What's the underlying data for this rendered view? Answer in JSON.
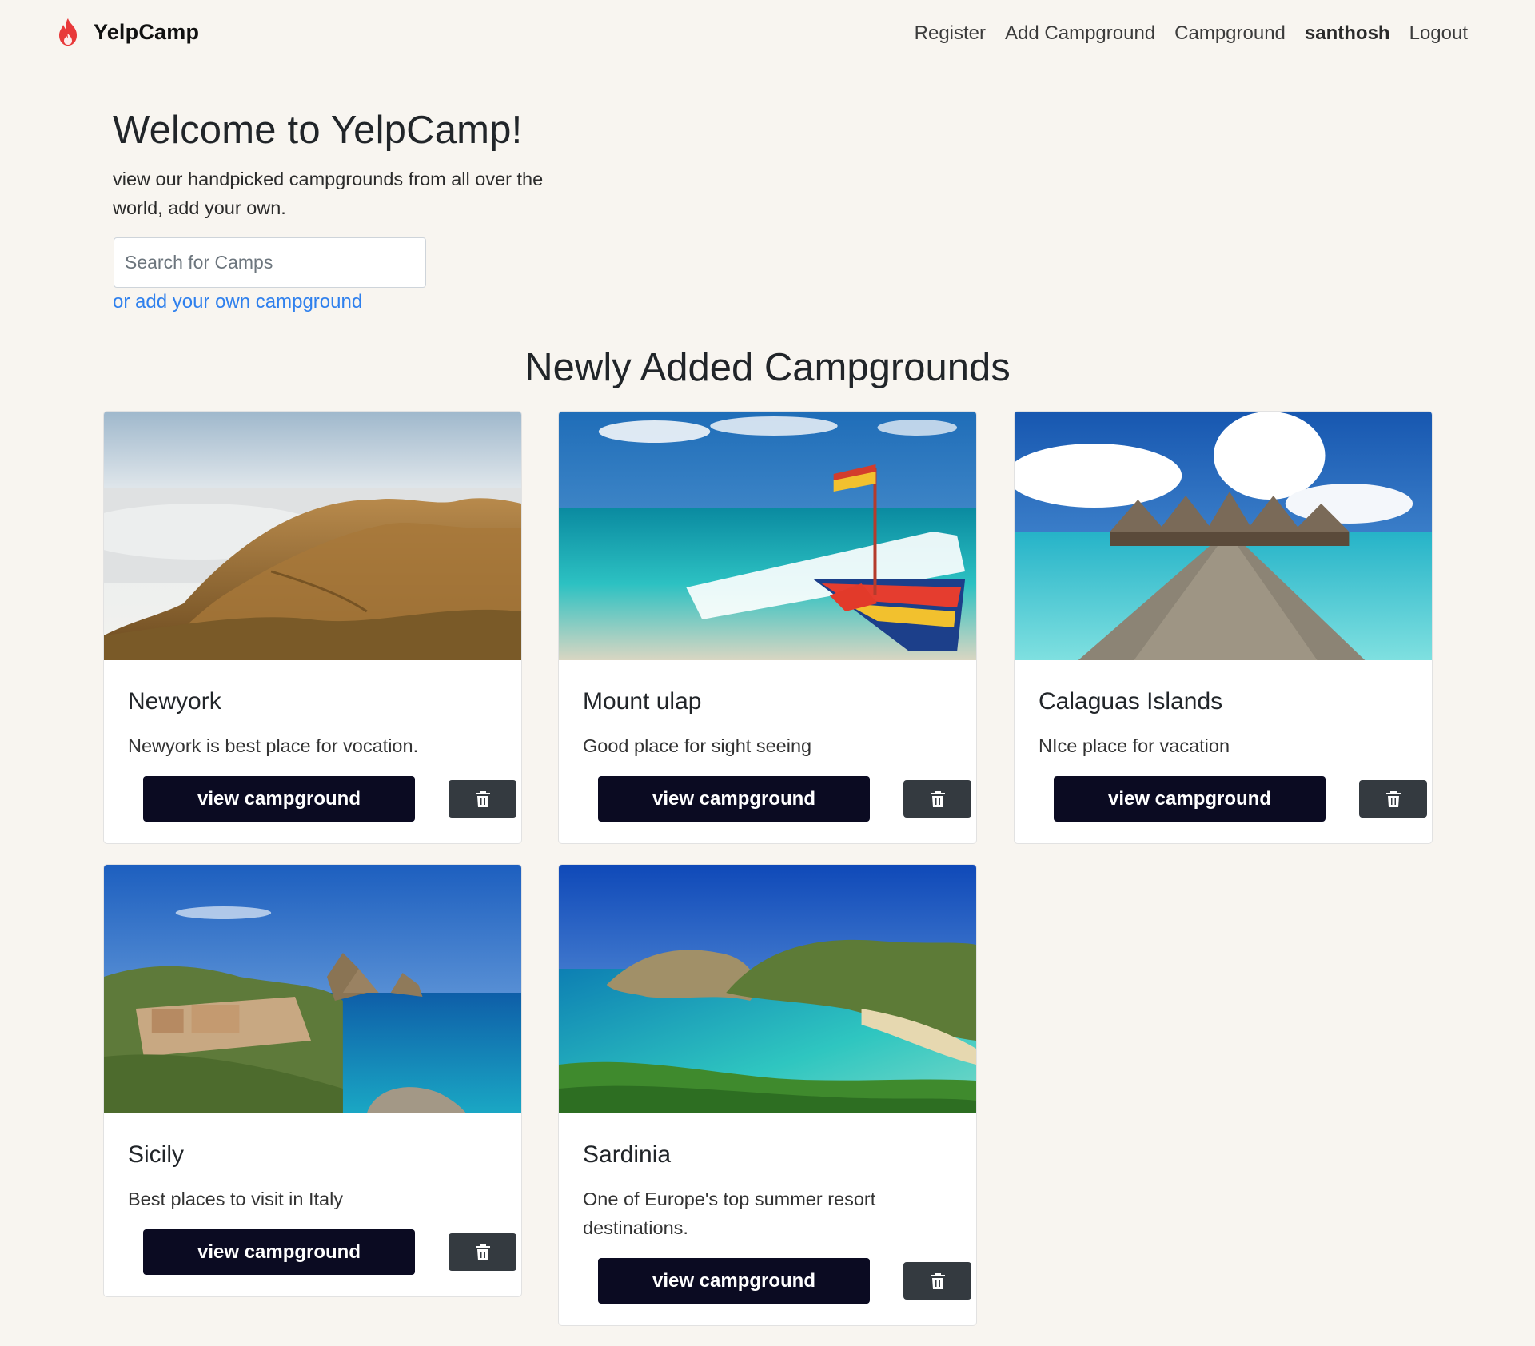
{
  "nav": {
    "brand": "YelpCamp",
    "links": [
      {
        "label": "Register"
      },
      {
        "label": "Add Campground"
      },
      {
        "label": "Campground"
      },
      {
        "label": "santhosh"
      },
      {
        "label": "Logout"
      }
    ]
  },
  "hero": {
    "title": "Welcome to YelpCamp!",
    "subtitle": "view our handpicked campgrounds from all over the world, add your own.",
    "search_placeholder": "Search for Camps",
    "add_link": "or add your own campground"
  },
  "section_title": "Newly Added Campgrounds",
  "campgrounds": [
    {
      "title": "Newyork",
      "description": "Newyork is best place for vocation.",
      "button": "view campground",
      "image": "misty-hills-photo"
    },
    {
      "title": "Mount ulap",
      "description": "Good place for sight seeing",
      "button": "view campground",
      "image": "outrigger-boat-beach-photo"
    },
    {
      "title": "Calaguas Islands",
      "description": "NIce place for vacation",
      "button": "view campground",
      "image": "overwater-huts-pier-photo"
    },
    {
      "title": "Sicily",
      "description": "Best places to visit in Italy",
      "button": "view campground",
      "image": "sicily-coast-photo"
    },
    {
      "title": "Sardinia",
      "description": "One of Europe's top summer resort destinations.",
      "button": "view campground",
      "image": "sardinia-bay-photo"
    }
  ],
  "colors": {
    "background": "#f8f5f0",
    "button_primary": "#0b0b22",
    "button_delete": "#343a40",
    "link": "#2f80ed",
    "flame": "#e8393a"
  }
}
